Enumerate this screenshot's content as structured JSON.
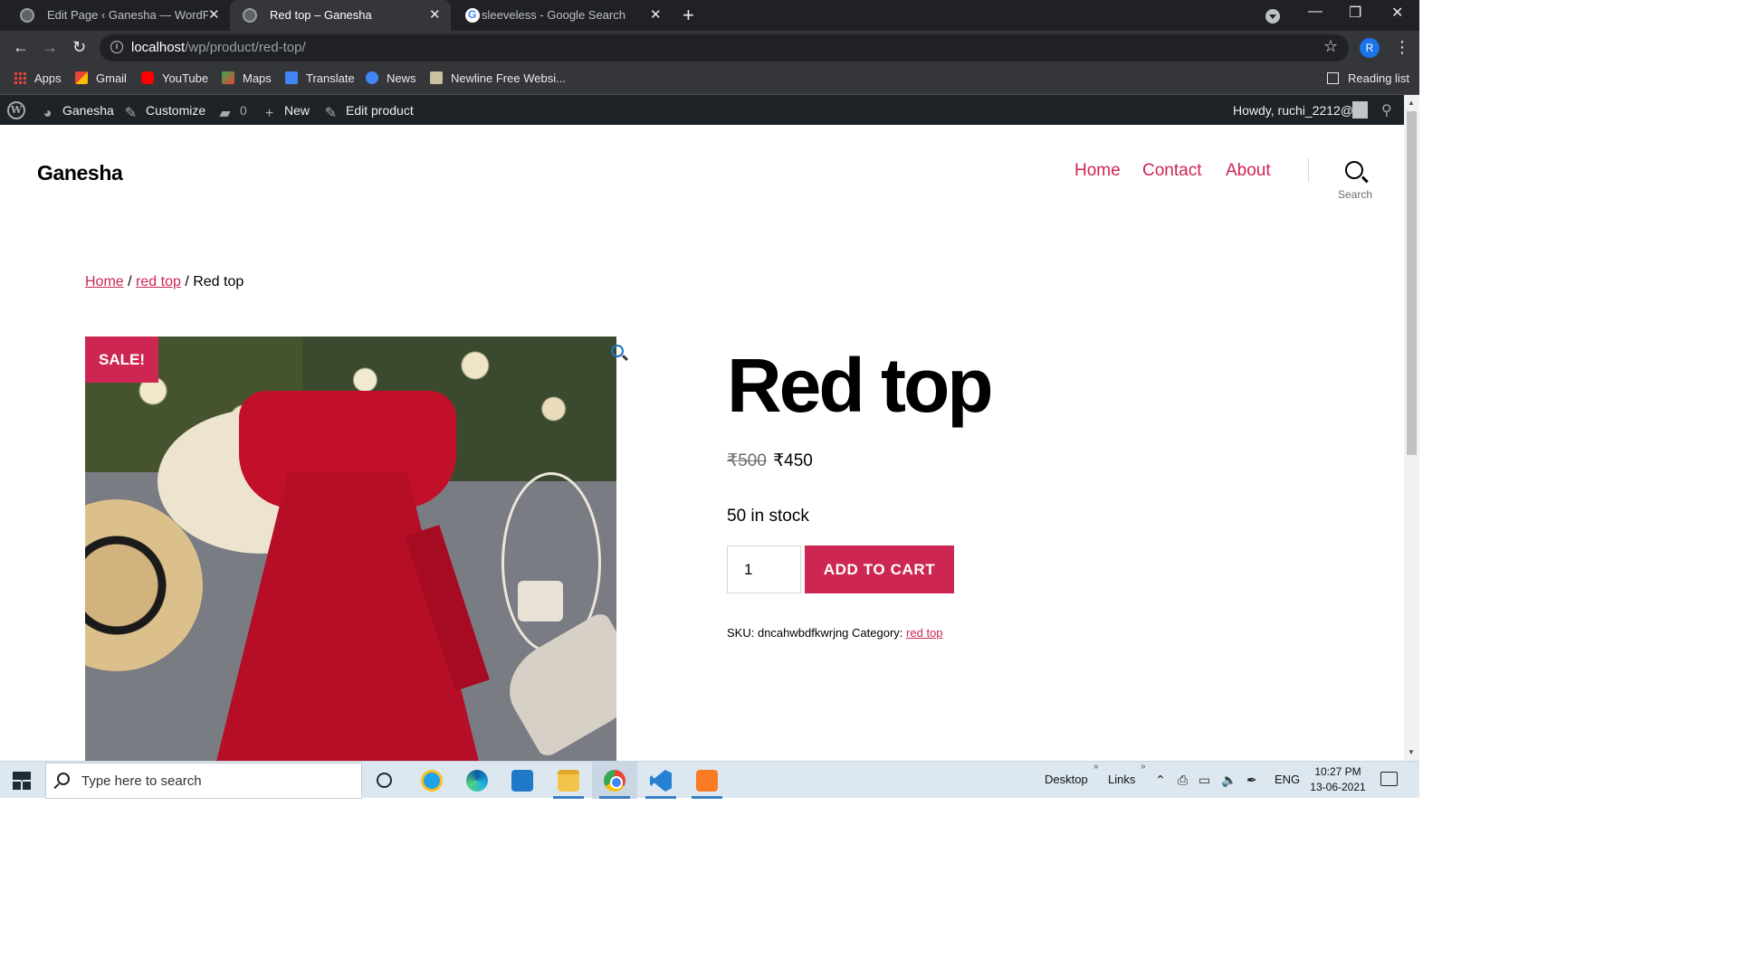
{
  "browser": {
    "tabs": [
      {
        "title": "Edit Page ‹ Ganesha — WordPress",
        "active": false
      },
      {
        "title": "Red top – Ganesha",
        "active": true
      },
      {
        "title": "sleeveless - Google Search",
        "active": false
      }
    ],
    "address": {
      "host": "localhost",
      "path": "/wp/product/red-top/"
    },
    "profile_initial": "R",
    "bookmarks": [
      {
        "label": "Apps",
        "icon": "apps-grid-icon"
      },
      {
        "label": "Gmail",
        "icon": "gmail-icon"
      },
      {
        "label": "YouTube",
        "icon": "youtube-icon"
      },
      {
        "label": "Maps",
        "icon": "maps-icon"
      },
      {
        "label": "Translate",
        "icon": "translate-icon"
      },
      {
        "label": "News",
        "icon": "news-icon"
      },
      {
        "label": "Newline Free Websi...",
        "icon": "bookmark-favicon"
      }
    ],
    "reading_list": "Reading list"
  },
  "admin_bar": {
    "site": "Ganesha",
    "customize": "Customize",
    "comments_count": "0",
    "new": "New",
    "edit_product": "Edit product",
    "howdy": "Howdy, ruchi_2212@"
  },
  "site": {
    "title": "Ganesha",
    "nav": [
      "Home",
      "Contact",
      "About"
    ],
    "search_label": "Search",
    "accent_color": "#cd2653"
  },
  "breadcrumb": {
    "home": "Home",
    "category": "red top",
    "current": "Red top",
    "separator": "/"
  },
  "product": {
    "sale_badge": "SALE!",
    "title": "Red top",
    "price_regular": "₹500",
    "price_sale": "₹450",
    "stock": "50 in stock",
    "quantity": "1",
    "add_to_cart": "ADD TO CART",
    "sku_label": "SKU:",
    "sku": "dncahwbdfkwrjng",
    "category_label": "Category:",
    "category": "red top"
  },
  "taskbar": {
    "search_placeholder": "Type here to search",
    "desktop": "Desktop",
    "links": "Links",
    "language": "ENG",
    "time": "10:27 PM",
    "date": "13-06-2021"
  }
}
